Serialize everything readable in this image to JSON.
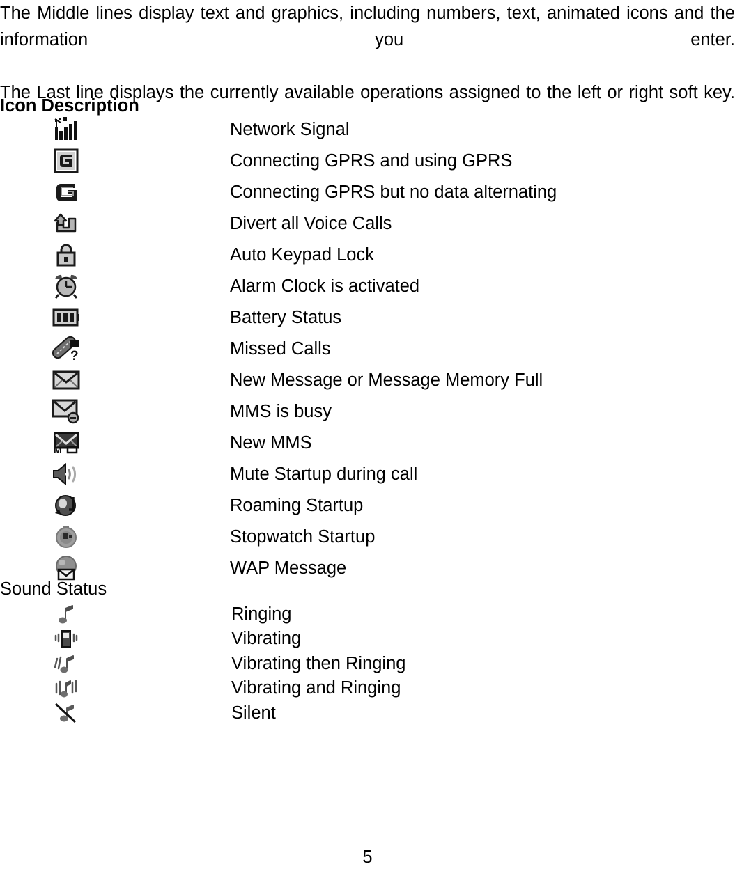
{
  "body_text": {
    "paragraph_1": "The Middle lines display text and graphics, including numbers, text, animated icons and the information you enter.",
    "paragraph_2": "The Last line displays the currently available operations assigned to the left or right soft key."
  },
  "icon_description": {
    "heading": "Icon Description",
    "rows": [
      {
        "icon": "network-signal-icon",
        "label": "Network Signal"
      },
      {
        "icon": "gprs-connected-boxed-icon",
        "label": "Connecting GPRS and using GPRS"
      },
      {
        "icon": "gprs-idle-icon",
        "label": "Connecting GPRS but no data alternating"
      },
      {
        "icon": "call-divert-icon",
        "label": "Divert all Voice Calls"
      },
      {
        "icon": "keypad-lock-icon",
        "label": "Auto Keypad Lock"
      },
      {
        "icon": "alarm-clock-icon",
        "label": "Alarm Clock is activated"
      },
      {
        "icon": "battery-status-icon",
        "label": "Battery Status"
      },
      {
        "icon": "missed-call-icon",
        "label": "Missed Calls"
      },
      {
        "icon": "new-message-icon",
        "label": "New Message or Message Memory Full"
      },
      {
        "icon": "mms-busy-icon",
        "label": "MMS is busy"
      },
      {
        "icon": "new-mms-icon",
        "label": "New MMS"
      },
      {
        "icon": "mute-speaker-icon",
        "label": "Mute Startup during call"
      },
      {
        "icon": "roaming-icon",
        "label": "Roaming Startup"
      },
      {
        "icon": "stopwatch-icon",
        "label": "Stopwatch Startup"
      },
      {
        "icon": "wap-message-icon",
        "label": "WAP Message"
      }
    ]
  },
  "sound_status": {
    "heading": "Sound Status",
    "rows": [
      {
        "icon": "ringing-note-icon",
        "label": "Ringing"
      },
      {
        "icon": "vibrating-phone-icon",
        "label": "Vibrating"
      },
      {
        "icon": "vibrate-then-ring-icon",
        "label": "Vibrating then Ringing"
      },
      {
        "icon": "vibrate-and-ring-icon",
        "label": "Vibrating and Ringing"
      },
      {
        "icon": "silent-icon",
        "label": "Silent"
      }
    ]
  },
  "footer": {
    "page_number": "5"
  },
  "colors": {
    "text": "#000000",
    "background": "#ffffff",
    "icon_dark": "#1a1a1a",
    "icon_mid": "#808080",
    "icon_light": "#c8c8c8"
  }
}
